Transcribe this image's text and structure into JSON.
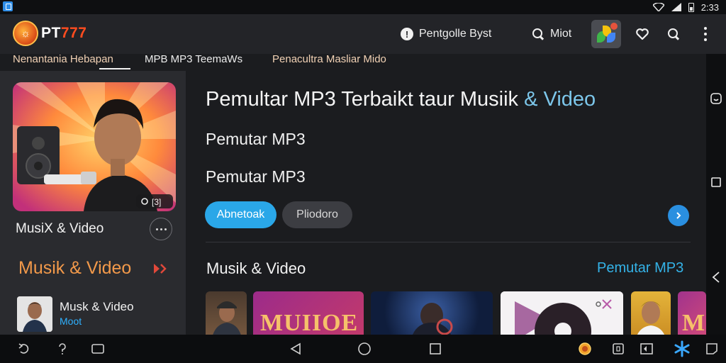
{
  "status_bar": {
    "time": "2:33"
  },
  "app_bar": {
    "logo_text_prefix": "PT",
    "logo_text_number": "777",
    "guide_label": "Pentgolle Byst",
    "search_label": "Miot"
  },
  "tabs": [
    {
      "label": "Nenantania Hebapan"
    },
    {
      "label": "MPB MP3 TeemaWs"
    },
    {
      "label": "Penacultra Masliar Mido"
    }
  ],
  "sidebar": {
    "album_card": {
      "badge_count": "[3]"
    },
    "album_title": "MusiX & Video",
    "section_title": "Musik & Video",
    "track": {
      "title": "Musk & Video",
      "subtitle": "Moot"
    }
  },
  "main": {
    "headline_main": "Pemultar MP3 Terbaikt taur Musiik",
    "headline_accent": "& Video",
    "subtitle_1": "Pemutar MP3",
    "subtitle_2": "Pemutar MP3",
    "primary_button": "Abnetoak",
    "secondary_button": "Pliodoro",
    "section_title": "Musik & Video",
    "section_link": "Pemutar MP3",
    "thumbnails": [
      {
        "overlay_text": ""
      },
      {
        "overlay_text": "MUIIOE"
      },
      {
        "overlay_text": ""
      },
      {
        "overlay_text": ""
      },
      {
        "overlay_text": ""
      },
      {
        "overlay_text": "M"
      }
    ]
  },
  "colors": {
    "accent_blue": "#2aa7e8",
    "accent_orange": "#f2994a",
    "logo_red": "#ff4c1f",
    "background": "#1b1c1f"
  }
}
